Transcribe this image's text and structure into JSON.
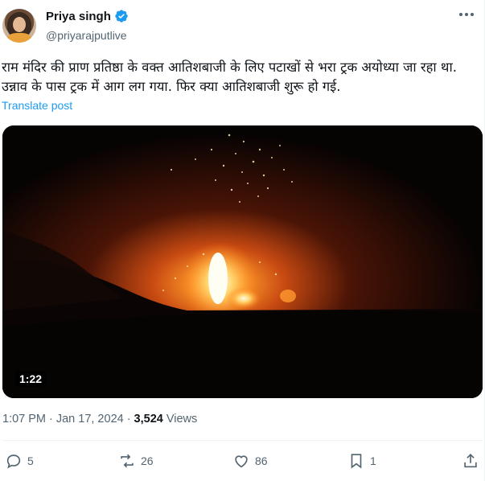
{
  "user": {
    "name": "Priya singh",
    "handle": "@priyarajputlive",
    "verified": true
  },
  "tweet": {
    "text": "राम मंदिर की प्राण प्रतिष्ठा के वक्त आतिशबाजी के लिए पटाखों से भरा ट्रक अयोध्या जा रहा था. उन्नाव के पास ट्रक में आग लग गया. फिर क्या आतिशबाजी शुरू हो गई.",
    "translate_label": "Translate post"
  },
  "media": {
    "type": "video",
    "duration": "1:22"
  },
  "meta": {
    "time": "1:07 PM",
    "separator": "·",
    "date": "Jan 17, 2024",
    "views_count": "3,524",
    "views_label": "Views"
  },
  "actions": {
    "replies": "5",
    "reposts": "26",
    "likes": "86",
    "bookmarks": "1"
  },
  "colors": {
    "accent": "#1d9bf0",
    "secondary_text": "#536471",
    "fire": "#ff8a1c"
  }
}
